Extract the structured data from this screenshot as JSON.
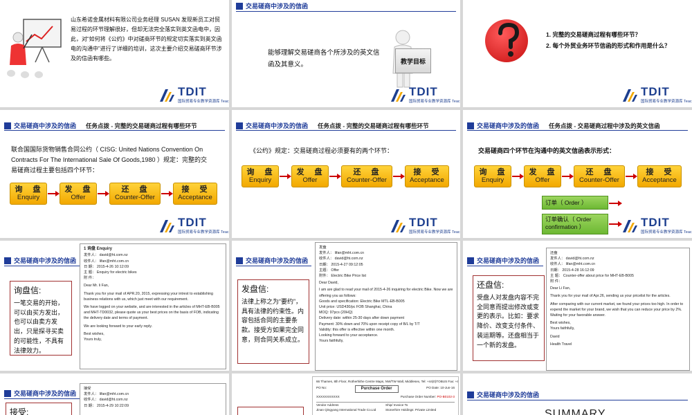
{
  "header_title": "交易磋商中涉及的信函",
  "task_title_1": "任务点拨 - 完整的交易磋商过程有哪些环节",
  "task_title_2": "任务点拨 - 交易磋商过程中涉及的英文信函",
  "logo": {
    "name": "TDIT",
    "subtitle": "国际贸易专业教学资源库 Teaching Database in International Trade"
  },
  "slide1": {
    "paragraph": "山东希诺金属材料有限公司业务经理 SUSAN 发现新员工对贸易过程的环节理解很好，但却无法完全落实到英文函电中，因此，对“如何将《公约》中对磋商环节的规定切实落实到英文函电的沟通中”进行了详细的培训，这次主要介绍交易磋商环节涉及的信函有哪些。"
  },
  "slide2": {
    "paragraph": "能够理解交易磋商各个所涉及的英文信函及其意义。",
    "board_label": "教学目标"
  },
  "slide3": {
    "q1": "1. 完整的交易磋商过程有哪些环节？",
    "q2": "2. 每个外贸业务环节信函的形式和作用是什么？"
  },
  "slide4": {
    "paragraph": "联合国国际货物销售合同公约（ CISG: United Nations Convention On Contracts For The International Sale Of Goods,1980 ）规定：完整的交易磋商过程主要包括四个环节："
  },
  "slide5": {
    "paragraph": "《公约》规定：交易磋商过程必须要有的两个环节："
  },
  "slide6": {
    "paragraph": "交易磋商四个环节在沟通中的英文信函表示形式：",
    "order": "订单（ Order ）",
    "order_confirm": "订单确认（ Order confirmation ）"
  },
  "stages": [
    {
      "cn": "询　盘",
      "en": "Enquiry"
    },
    {
      "cn": "发　盘",
      "en": "Offer"
    },
    {
      "cn": "还　盘",
      "en": "Counter-Offer"
    },
    {
      "cn": "接　受",
      "en": "Acceptance"
    }
  ],
  "slide7": {
    "box_title": "询盘信:",
    "box_text": "一笔交易的开始，可以由买方发出，也可以由卖方发出，只是探寻买卖的可能性，不具有法律效力。",
    "doc_heading": "1 询盘 Enquiry",
    "doc_lines": [
      "发件人： david@ht.com.nz",
      "收件人： lifan@mht.com.cn",
      "日 期： 2015-4-26 10:12:09",
      "主 题： Enquiry for electric bikes",
      "附 件：",
      "Dear Mr. li Fan,",
      "Thank you for your mail of APR.20, 2015, expressing your intrest to establishing business relations with us, which just meet with our requirement.",
      "We have logged on your website, and are interested in the articles of MHT-EB-B005 and MHT-TD0032, please quote us your best prices on the basis of FOB, indicating the delivery date and terms of payment.",
      "We are looking forward to your early reply.",
      "Best wishes,",
      "Yours truly,"
    ]
  },
  "slide8": {
    "box_title": "发盘信:",
    "box_text": "法律上称之为“要约”，具有法律的约束性。内容包括合同的主要条款。接受方如果完全同意，则合同关系成立。",
    "doc_lines": [
      "发盘",
      "发件人： lifan@mht.com.cn",
      "收件人： david@ht.com.nz",
      "日期： 2015-4-27 09:12:05",
      "主题： Offer",
      "附件： Electric Bike Price list",
      "Dear David,",
      "I am are glad to read your mail of 2015-4-26 inquiring for electric Bike. Now we are offering you as follows:",
      "Goods and specification: Electric Bike MTL-EB-B005",
      "Unit price: USD430/pc FOB Shanghai, China",
      "MOQ: 97pcs (20HQ)",
      "Delivery date: within 25-30 days after down payment",
      "Payment: 30% down and 70% upon receipt copy of B/L by T/T",
      "Validity: this offer is effective within one month.",
      "Looking forward to your acceptance.",
      "Yours faithfully,"
    ]
  },
  "slide9": {
    "box_title": "还盘信:",
    "box_text": "受盘人对发盘内容不完全同意而提出修改或变更的表示。比如：要求降价、改变支付条件、装运期等。还盘相当于一个新的发盘。",
    "doc_lines": [
      "还盘",
      "发件人： david@ht.com.nz",
      "收件人： lifan@mht.com.cn",
      "日期： 2015-4-28 16:12:09",
      "主 题： Counter-offer about price for MHT-EB-B005",
      "附 件：",
      "Dear Li Fan,",
      "Thank you for your mail of Apr.26, sending us your pricelist for the articles.",
      "After comparing with our current market, we found your prices too high. In order to expend the market for your brand, we wish that you can reduce your price by 2%. Waiting for your favorable answer.",
      "Best wishes,",
      "Yours faithfully,",
      "David",
      "Health Travel"
    ]
  },
  "slide10": {
    "box_title": "接受:",
    "doc_lines": [
      "接受",
      "发件人： lifan@mht.com.cn",
      "收件人： david@ht.com.nz",
      "日 期： 2015-4-29 10:22:09"
    ]
  },
  "slide11": {
    "doc_title": "Purchase Order",
    "doc_top": "66 Thames, 8th Floor, Rotherhithe Centre Maps, NW/TW Wall, Middlesex, Tel: +44(0)TOBUS Fax: +44(0)TOBUS",
    "po_no_label": "PO No:",
    "po_date_label": "PO Date:",
    "po_date": "10-Jun-16",
    "purchase_label": "Purchase Order Number:",
    "purchase_no": "PO-B0102-3",
    "xx": "XXXXXXXXXXX",
    "vendor": "Vendor Address",
    "ship": "Ship/ Invoice To",
    "vendor_name": "Jinan Qingyang International Trade Co.Ltd",
    "ship_name": "Stonerhire Holdings: Private Limited"
  },
  "slide12": {
    "title": "SUMMARY"
  }
}
